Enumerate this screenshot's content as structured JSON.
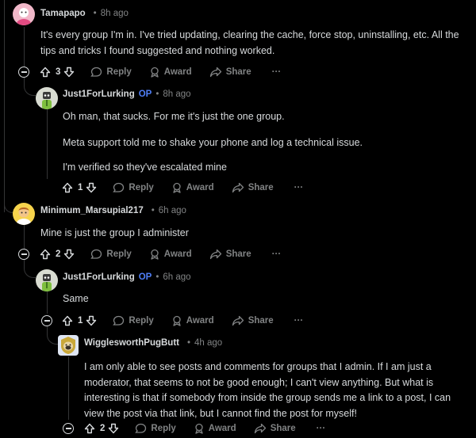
{
  "comments": [
    {
      "username": "Tamapapo",
      "op_badge": "",
      "separator": "•",
      "time": "8h ago",
      "paragraphs": [
        "It's every group I'm in. I've tried updating, clearing the cache, force stop, uninstalling, etc. All the tips and tricks I found suggested and nothing worked."
      ],
      "score": "3"
    },
    {
      "username": "Just1ForLurking",
      "op_badge": "OP",
      "separator": "•",
      "time": "8h ago",
      "paragraphs": [
        "Oh man, that sucks. For me it's just the one group.",
        "Meta support told me to shake your phone and log a technical issue.",
        "I'm verified so they've escalated mine"
      ],
      "score": "1"
    },
    {
      "username": "Minimum_Marsupial217",
      "op_badge": "",
      "separator": "•",
      "time": "6h ago",
      "paragraphs": [
        "Mine is just the group I administer"
      ],
      "score": "2"
    },
    {
      "username": "Just1ForLurking",
      "op_badge": "OP",
      "separator": "•",
      "time": "6h ago",
      "paragraphs": [
        "Same"
      ],
      "score": "1"
    },
    {
      "username": "WigglesworthPugButt",
      "op_badge": "",
      "separator": "•",
      "time": "4h ago",
      "paragraphs": [
        "I am only able to see posts and comments for groups that I admin. If I am just a moderator, that seems to not be good enough; I can't view anything. But what is interesting is that if somebody from inside the group sends me a link to a post, I can view the post via that link, but I cannot find the post for myself!"
      ],
      "score": "2"
    }
  ],
  "actions": {
    "reply": "Reply",
    "award": "Award",
    "share": "Share",
    "more": "···"
  },
  "icons": {
    "upvote": "upvote-arrow-icon",
    "downvote": "downvote-arrow-icon",
    "reply": "speech-bubble-icon",
    "award": "award-ribbon-icon",
    "share": "share-arrow-icon",
    "collapse": "collapse-minus-icon"
  },
  "colors": {
    "background": "#000000",
    "text": "#d7dadc",
    "muted": "#818384",
    "op": "#4f7ef7",
    "thread_line": "#343536"
  }
}
